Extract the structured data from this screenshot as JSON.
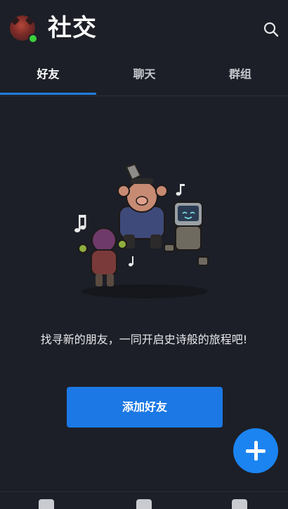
{
  "header": {
    "title": "社交",
    "avatar_icon": "demon-avatar-icon",
    "status_color": "#3ccf3c",
    "search_icon": "search-icon"
  },
  "tabs": [
    {
      "label": "好友",
      "active": true
    },
    {
      "label": "聊天",
      "active": false
    },
    {
      "label": "群组",
      "active": false
    }
  ],
  "empty_state": {
    "illustration": "party-characters-illustration",
    "message": "找寻新的朋友，一同开启史诗般的旅程吧!",
    "button_label": "添加好友"
  },
  "fab": {
    "icon": "plus-icon"
  },
  "bottom_nav": [
    "friends-icon",
    "cards-icon",
    "document-icon"
  ],
  "colors": {
    "accent": "#1b78e4",
    "background": "#1c1f27",
    "fab": "#1b84f0"
  }
}
